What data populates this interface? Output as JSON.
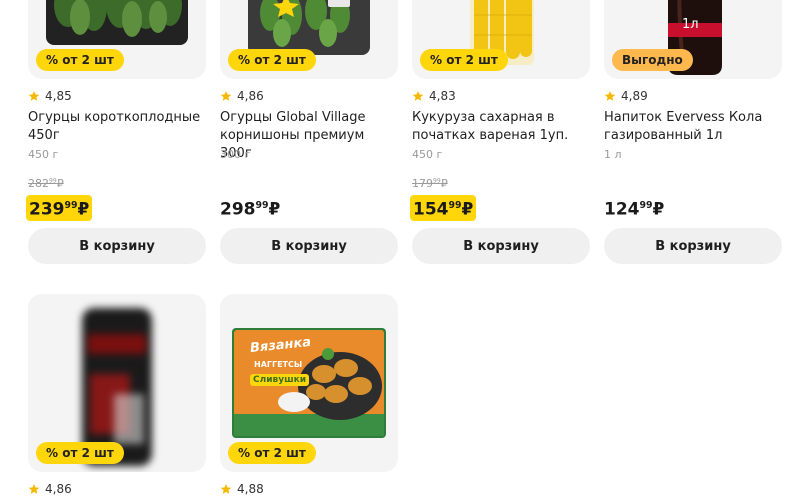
{
  "products_row1": [
    {
      "badge": "% от 2 шт",
      "badge_color": "#ffd60a",
      "rating": "4,85",
      "title": "Огурцы короткоплодные 450г",
      "weight": "450 г",
      "old_price_main": "282",
      "old_price_cents": "99",
      "old_price_currency": "₽",
      "price_main": "239",
      "price_cents": "99",
      "price_currency": "₽",
      "promo": true,
      "cart_label": "В корзину"
    },
    {
      "badge": "% от 2 шт",
      "badge_color": "#ffd60a",
      "rating": "4,86",
      "title": "Огурцы Global Village корнишоны премиум 300г",
      "weight": "300 г",
      "price_main": "298",
      "price_cents": "99",
      "price_currency": "₽",
      "promo": false,
      "cart_label": "В корзину"
    },
    {
      "badge": "% от 2 шт",
      "badge_color": "#ffd60a",
      "rating": "4,83",
      "title": "Кукуруза сахарная в початках вареная 1уп.",
      "weight": "450 г",
      "old_price_main": "179",
      "old_price_cents": "99",
      "old_price_currency": "₽",
      "price_main": "154",
      "price_cents": "99",
      "price_currency": "₽",
      "promo": true,
      "cart_label": "В корзину"
    },
    {
      "badge": "Выгодно",
      "badge_color": "#ffb84d",
      "image_text": "1л",
      "rating": "4,89",
      "title": "Напиток Evervess Кола газированный 1л",
      "weight": "1 л",
      "price_main": "124",
      "price_cents": "99",
      "price_currency": "₽",
      "promo": false,
      "cart_label": "В корзину"
    }
  ],
  "products_row2": [
    {
      "badge": "% от 2 шт",
      "rating": "4,86"
    },
    {
      "badge": "% от 2 шт",
      "rating": "4,88",
      "package_brand": "Вязанка",
      "package_line1": "НАГГЕТСЫ",
      "package_line2": "Сливушки"
    }
  ],
  "colors": {
    "accent_yellow": "#ffd60a",
    "badge_orange": "#ffb84d",
    "star": "#f5b800",
    "card_bg": "#f4f4f4",
    "button_bg": "#f0f0f0"
  },
  "icons": {
    "rating": "star-icon"
  }
}
